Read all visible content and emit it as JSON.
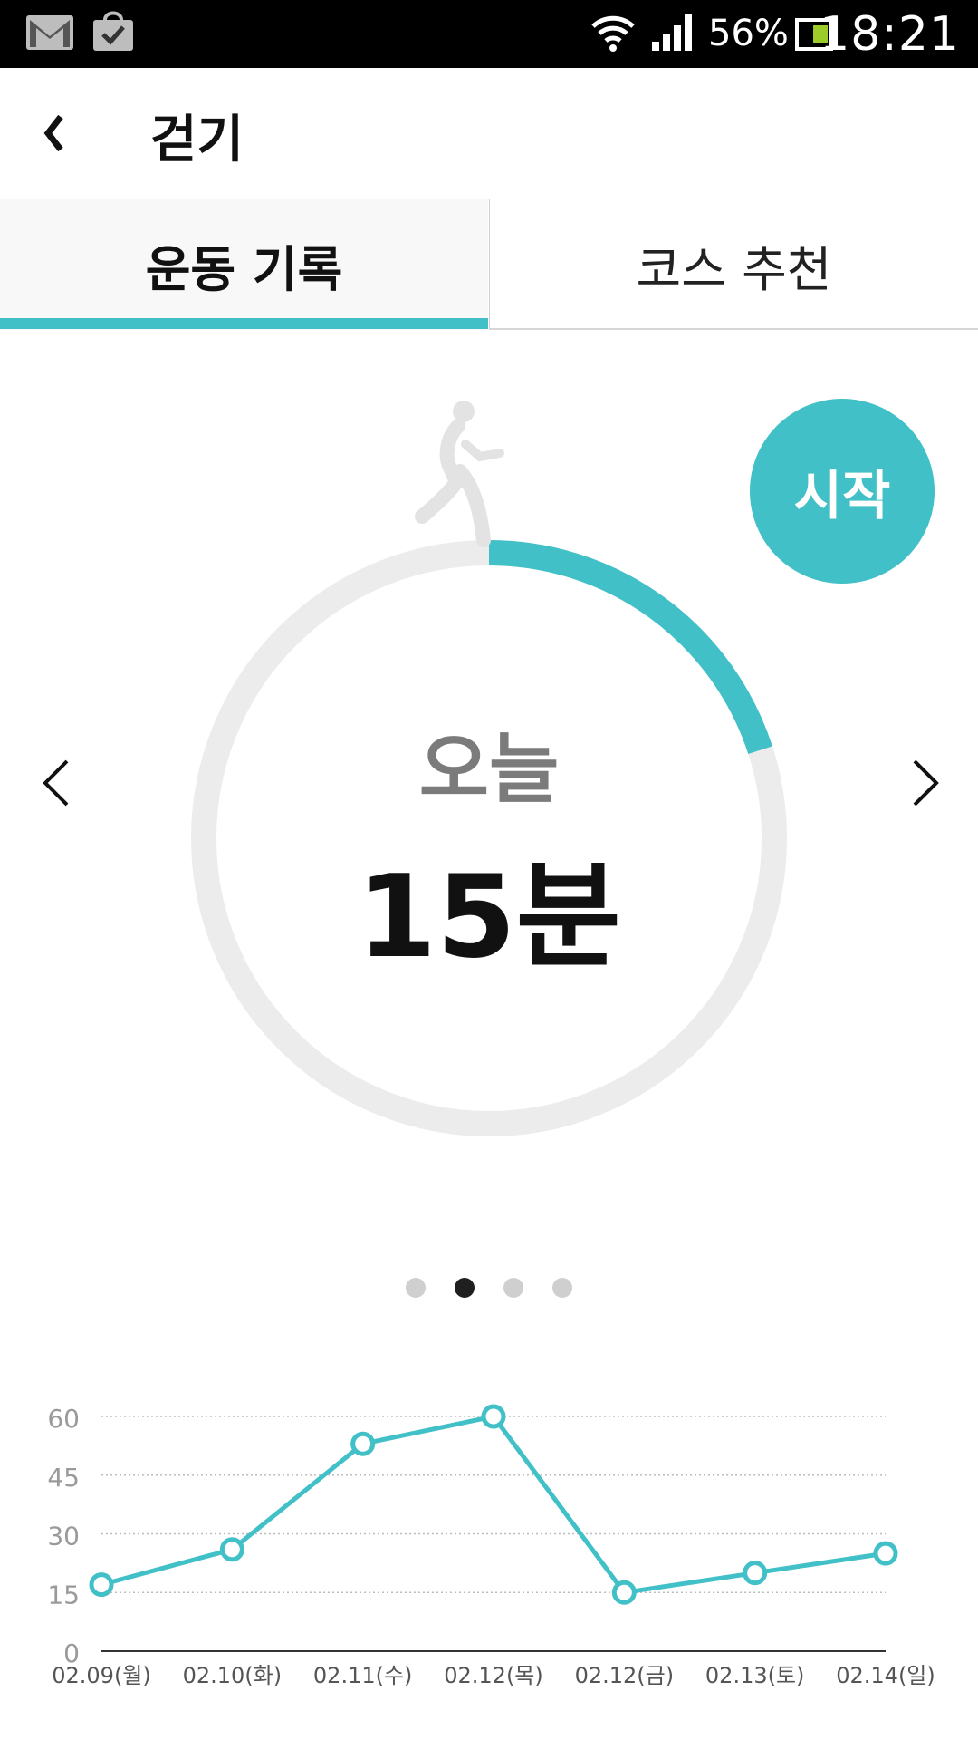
{
  "status_bar": {
    "battery_percent": "56%",
    "time": "18:21",
    "icons": [
      "gmail-icon",
      "shopping-bag-icon",
      "wifi-icon",
      "signal-icon",
      "battery-icon"
    ]
  },
  "header": {
    "title": "걷기",
    "back_icon": "chevron-left-icon"
  },
  "tabs": [
    {
      "label": "운동 기록",
      "active": true
    },
    {
      "label": "코스 추천",
      "active": false
    }
  ],
  "today": {
    "label": "오늘",
    "value": "15분",
    "progress": 0.2,
    "icon": "walking-person-icon"
  },
  "start_button": {
    "label": "시작"
  },
  "pager": {
    "count": 4,
    "active_index": 1
  },
  "colors": {
    "accent": "#41c0c7",
    "ring_track": "#ececec",
    "walker_icon": "#e3e3e3",
    "label_gray": "#7b7b7b"
  },
  "chart_data": {
    "type": "line",
    "categories": [
      "02.09(월)",
      "02.10(화)",
      "02.11(수)",
      "02.12(목)",
      "02.12(금)",
      "02.13(토)",
      "02.14(일)"
    ],
    "series": [
      {
        "values": [
          17,
          26,
          53,
          60,
          15,
          20,
          25
        ]
      }
    ],
    "yticks": [
      0,
      15,
      30,
      45,
      60
    ],
    "ylim": [
      0,
      60
    ],
    "grid": true,
    "title": "",
    "xlabel": "",
    "ylabel": ""
  }
}
